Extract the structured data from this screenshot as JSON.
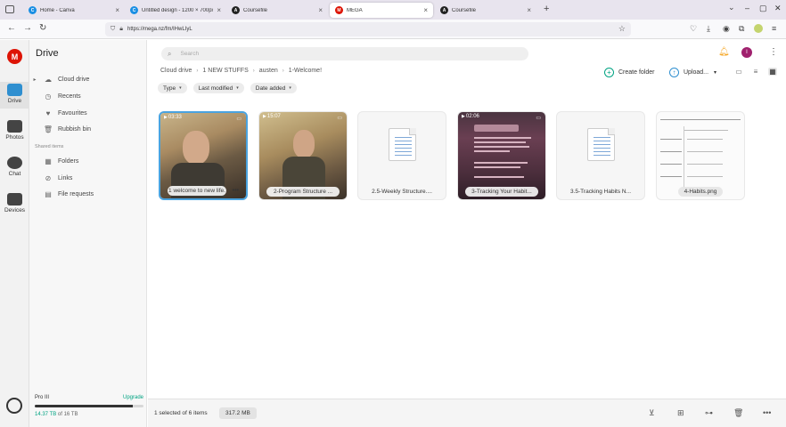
{
  "browser": {
    "tabs": [
      {
        "title": "Home - Canva",
        "favicon_color": "#1a8fe3",
        "favicon_letter": "C",
        "active": false
      },
      {
        "title": "Untitled design - 1200 × 700px",
        "favicon_color": "#1a8fe3",
        "favicon_letter": "C",
        "active": false
      },
      {
        "title": "Coursefile",
        "favicon_color": "#222222",
        "favicon_letter": "A",
        "active": false
      },
      {
        "title": "MEGA",
        "favicon_color": "#dd1405",
        "favicon_letter": "M",
        "active": true
      },
      {
        "title": "Coursefile",
        "favicon_color": "#222222",
        "favicon_letter": "A",
        "active": false
      }
    ],
    "url": "https://mega.nz/fm/IHwLIyL"
  },
  "rail": {
    "logo_letter": "M",
    "items": [
      {
        "label": "Drive",
        "icon": "folder-icon",
        "active": true
      },
      {
        "label": "Photos",
        "icon": "photos-icon",
        "active": false
      },
      {
        "label": "Chat",
        "icon": "chat-icon",
        "active": false
      },
      {
        "label": "Devices",
        "icon": "devices-icon",
        "active": false
      }
    ]
  },
  "sidebar": {
    "title": "Drive",
    "items": [
      {
        "label": "Cloud drive",
        "icon": "cloud-icon"
      },
      {
        "label": "Recents",
        "icon": "clock-icon"
      },
      {
        "label": "Favourites",
        "icon": "heart-icon"
      },
      {
        "label": "Rubbish bin",
        "icon": "trash-icon"
      }
    ],
    "shared_heading": "Shared items",
    "shared_items": [
      {
        "label": "Folders",
        "icon": "shared-folder-icon"
      },
      {
        "label": "Links",
        "icon": "link-icon"
      },
      {
        "label": "File requests",
        "icon": "file-request-icon"
      }
    ],
    "plan": {
      "name": "Pro III",
      "upgrade": "Upgrade",
      "used": "14.37 TB",
      "total": "of 16 TB",
      "used_fraction": 0.9
    }
  },
  "main": {
    "search_placeholder": "Search",
    "breadcrumb": [
      "Cloud drive",
      "1 NEW STUFFS",
      "austen",
      "1-Welcome!"
    ],
    "create_folder": "Create folder",
    "upload": "Upload...",
    "filters": [
      "Type",
      "Last modified",
      "Date added"
    ],
    "files": [
      {
        "name": "1 welcome to new life.",
        "duration": "03:33",
        "kind": "video",
        "selected": true
      },
      {
        "name": "2-Program Structure ...",
        "duration": "15:07",
        "kind": "video",
        "selected": false
      },
      {
        "name": "2.5-Weekly Structure....",
        "duration": "",
        "kind": "doc",
        "selected": false
      },
      {
        "name": "3-Tracking Your Habit...",
        "duration": "02:06",
        "kind": "video-dark",
        "selected": false
      },
      {
        "name": "3.5-Tracking Habits N...",
        "duration": "",
        "kind": "doc",
        "selected": false
      },
      {
        "name": "4-Habits.png",
        "duration": "",
        "kind": "image",
        "selected": false
      }
    ],
    "status": {
      "selection": "1 selected of 6 items",
      "size": "317.2 MB"
    }
  },
  "colors": {
    "mega_red": "#dd1405",
    "selection_blue": "#4aa3df",
    "upgrade_green": "#00a382"
  }
}
